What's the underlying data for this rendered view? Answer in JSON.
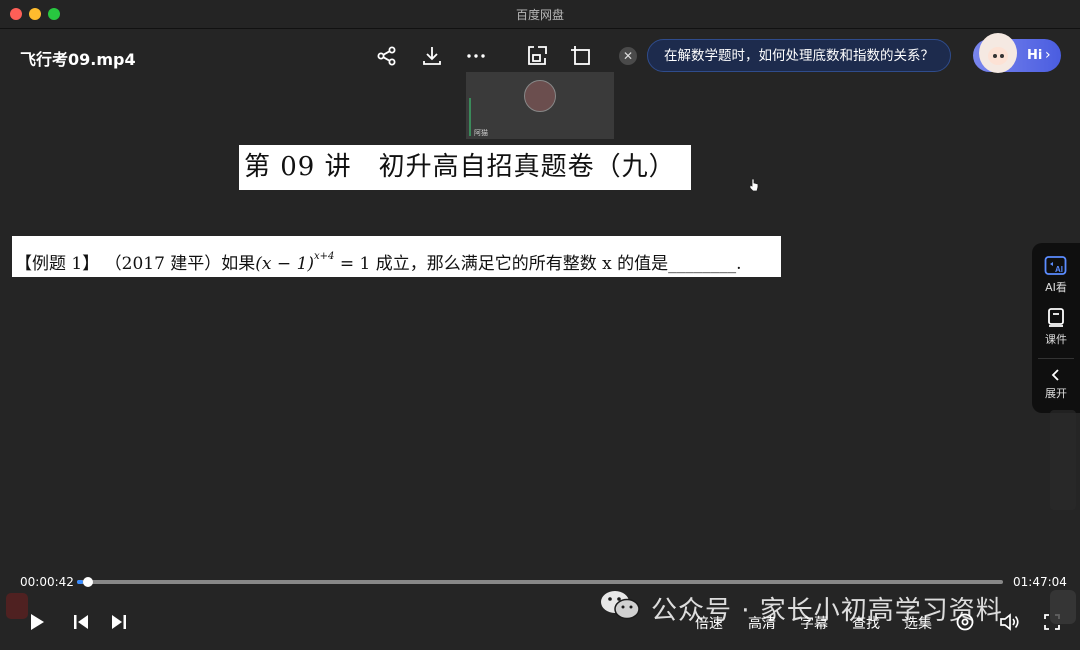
{
  "window": {
    "title": "百度网盘"
  },
  "player": {
    "file_name": "飞行考09.mp4",
    "ai_question": "在解数学题时，如何处理底数和指数的关系？",
    "hi_label": "Hi",
    "hi_chevron": "›",
    "close_glyph": "✕",
    "camera_name": "阿猫"
  },
  "slide": {
    "title": "第 09 讲　初升高自招真题卷（九）",
    "question_prefix": "【例题 1】 （2017 建平）如果",
    "question_base": "(x − 1)",
    "question_exponent": "x+4",
    "question_suffix": " = 1 成立，那么满足它的所有整数 x 的值是________."
  },
  "side_panel": {
    "ai_label": "AI看",
    "courseware_label": "课件",
    "expand_label": "展开"
  },
  "playback": {
    "current_time": "00:00:42",
    "total_time": "01:47:04",
    "progress": 0.0065
  },
  "controls": {
    "speed_label": "倍速",
    "quality_label": "高清",
    "subtitle_label": "字幕",
    "search_label": "查找",
    "episodes_label": "选集"
  },
  "watermark": {
    "text": "公众号 · 家长小初高学习资料"
  }
}
